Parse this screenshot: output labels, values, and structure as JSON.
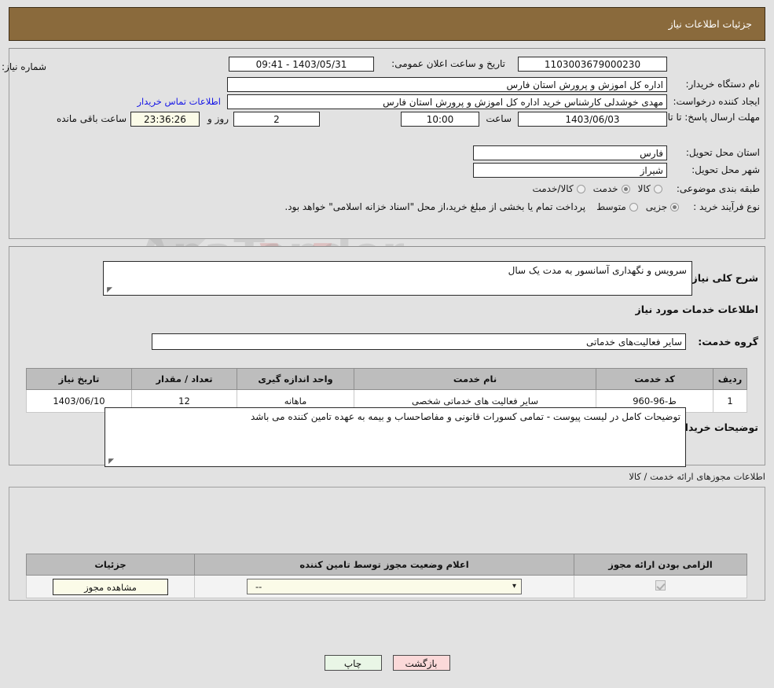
{
  "header": {
    "title": "جزئیات اطلاعات نیاز"
  },
  "info": {
    "need_number_label": "شماره نیاز:",
    "need_number_value": "1103003679000230",
    "announce_label": "تاریخ و ساعت اعلان عمومی:",
    "announce_value": "1403/05/31 - 09:41",
    "buyer_org_label": "نام دستگاه خریدار:",
    "buyer_org_value": "اداره کل اموزش و پرورش استان فارس",
    "creator_label": "ایجاد کننده درخواست:",
    "creator_value": "مهدی خوشدلی کارشناس خرید اداره کل اموزش و پرورش استان فارس",
    "contact_link": "اطلاعات تماس خریدار",
    "deadline_label": "مهلت ارسال پاسخ: تا تاریخ:",
    "deadline_date": "1403/06/03",
    "hour_label": "ساعت",
    "deadline_time": "10:00",
    "days_value": "2",
    "days_label": "روز و",
    "countdown_value": "23:36:26",
    "countdown_label": "ساعت باقی مانده",
    "province_label": "استان محل تحویل:",
    "province_value": "فارس",
    "city_label": "شهر محل تحویل:",
    "city_value": "شیراز",
    "category_label": "طبقه بندی موضوعی:",
    "category_options": [
      {
        "label": "کالا",
        "selected": false
      },
      {
        "label": "خدمت",
        "selected": true
      },
      {
        "label": "کالا/خدمت",
        "selected": false
      }
    ],
    "process_label": "نوع فرآیند خرید :",
    "process_options": [
      {
        "label": "جزیی",
        "selected": true
      },
      {
        "label": "متوسط",
        "selected": false
      }
    ],
    "payment_note": "پرداخت تمام یا بخشی از مبلغ خرید،از محل \"اسناد خزانه اسلامی\" خواهد بود."
  },
  "need": {
    "summary_label": "شرح کلی نیاز:",
    "summary_value": "سرویس و نگهداری آسانسور به مدت یک سال",
    "services_heading": "اطلاعات خدمات مورد نیاز",
    "service_group_label": "گروه خدمت:",
    "service_group_value": "سایر فعالیت‌های خدماتی"
  },
  "items_table": {
    "headers": [
      "ردیف",
      "کد خدمت",
      "نام خدمت",
      "واحد اندازه گیری",
      "تعداد / مقدار",
      "تاریخ نیاز"
    ],
    "rows": [
      {
        "row": "1",
        "code": "ط-96-960",
        "name": "سایر فعالیت های خدماتی شخصی",
        "unit": "ماهانه",
        "qty": "12",
        "date": "1403/06/10"
      }
    ]
  },
  "buyer_notes": {
    "label": "توضیحات خریدار:",
    "value": "توضیحات کامل در لیست پیوست - تمامی کسورات قانونی و مفاصاحساب و بیمه به عهده تامین کننده می باشد"
  },
  "permits": {
    "caption": "اطلاعات مجوزهای ارائه خدمت / کالا",
    "headers": [
      "الزامی بودن ارائه مجوز",
      "اعلام وضعیت مجوز توسط تامین کننده",
      "جزئیات"
    ],
    "rows": [
      {
        "required_checked": true,
        "status_value": "--",
        "details_button": "مشاهده مجوز"
      }
    ]
  },
  "footer": {
    "print_label": "چاپ",
    "back_label": "بازگشت"
  },
  "watermark": {
    "text_main": "AnaTender",
    "text_sub": ".net"
  },
  "colors": {
    "header_bar": "#8a6a3c",
    "page_bg": "#e2e2e2",
    "link": "#1414e6",
    "print_btn": "#e9f6e6",
    "back_btn": "#fbd9d9",
    "cream_field": "#fbfbe8",
    "table_header": "#bdbdbd"
  }
}
